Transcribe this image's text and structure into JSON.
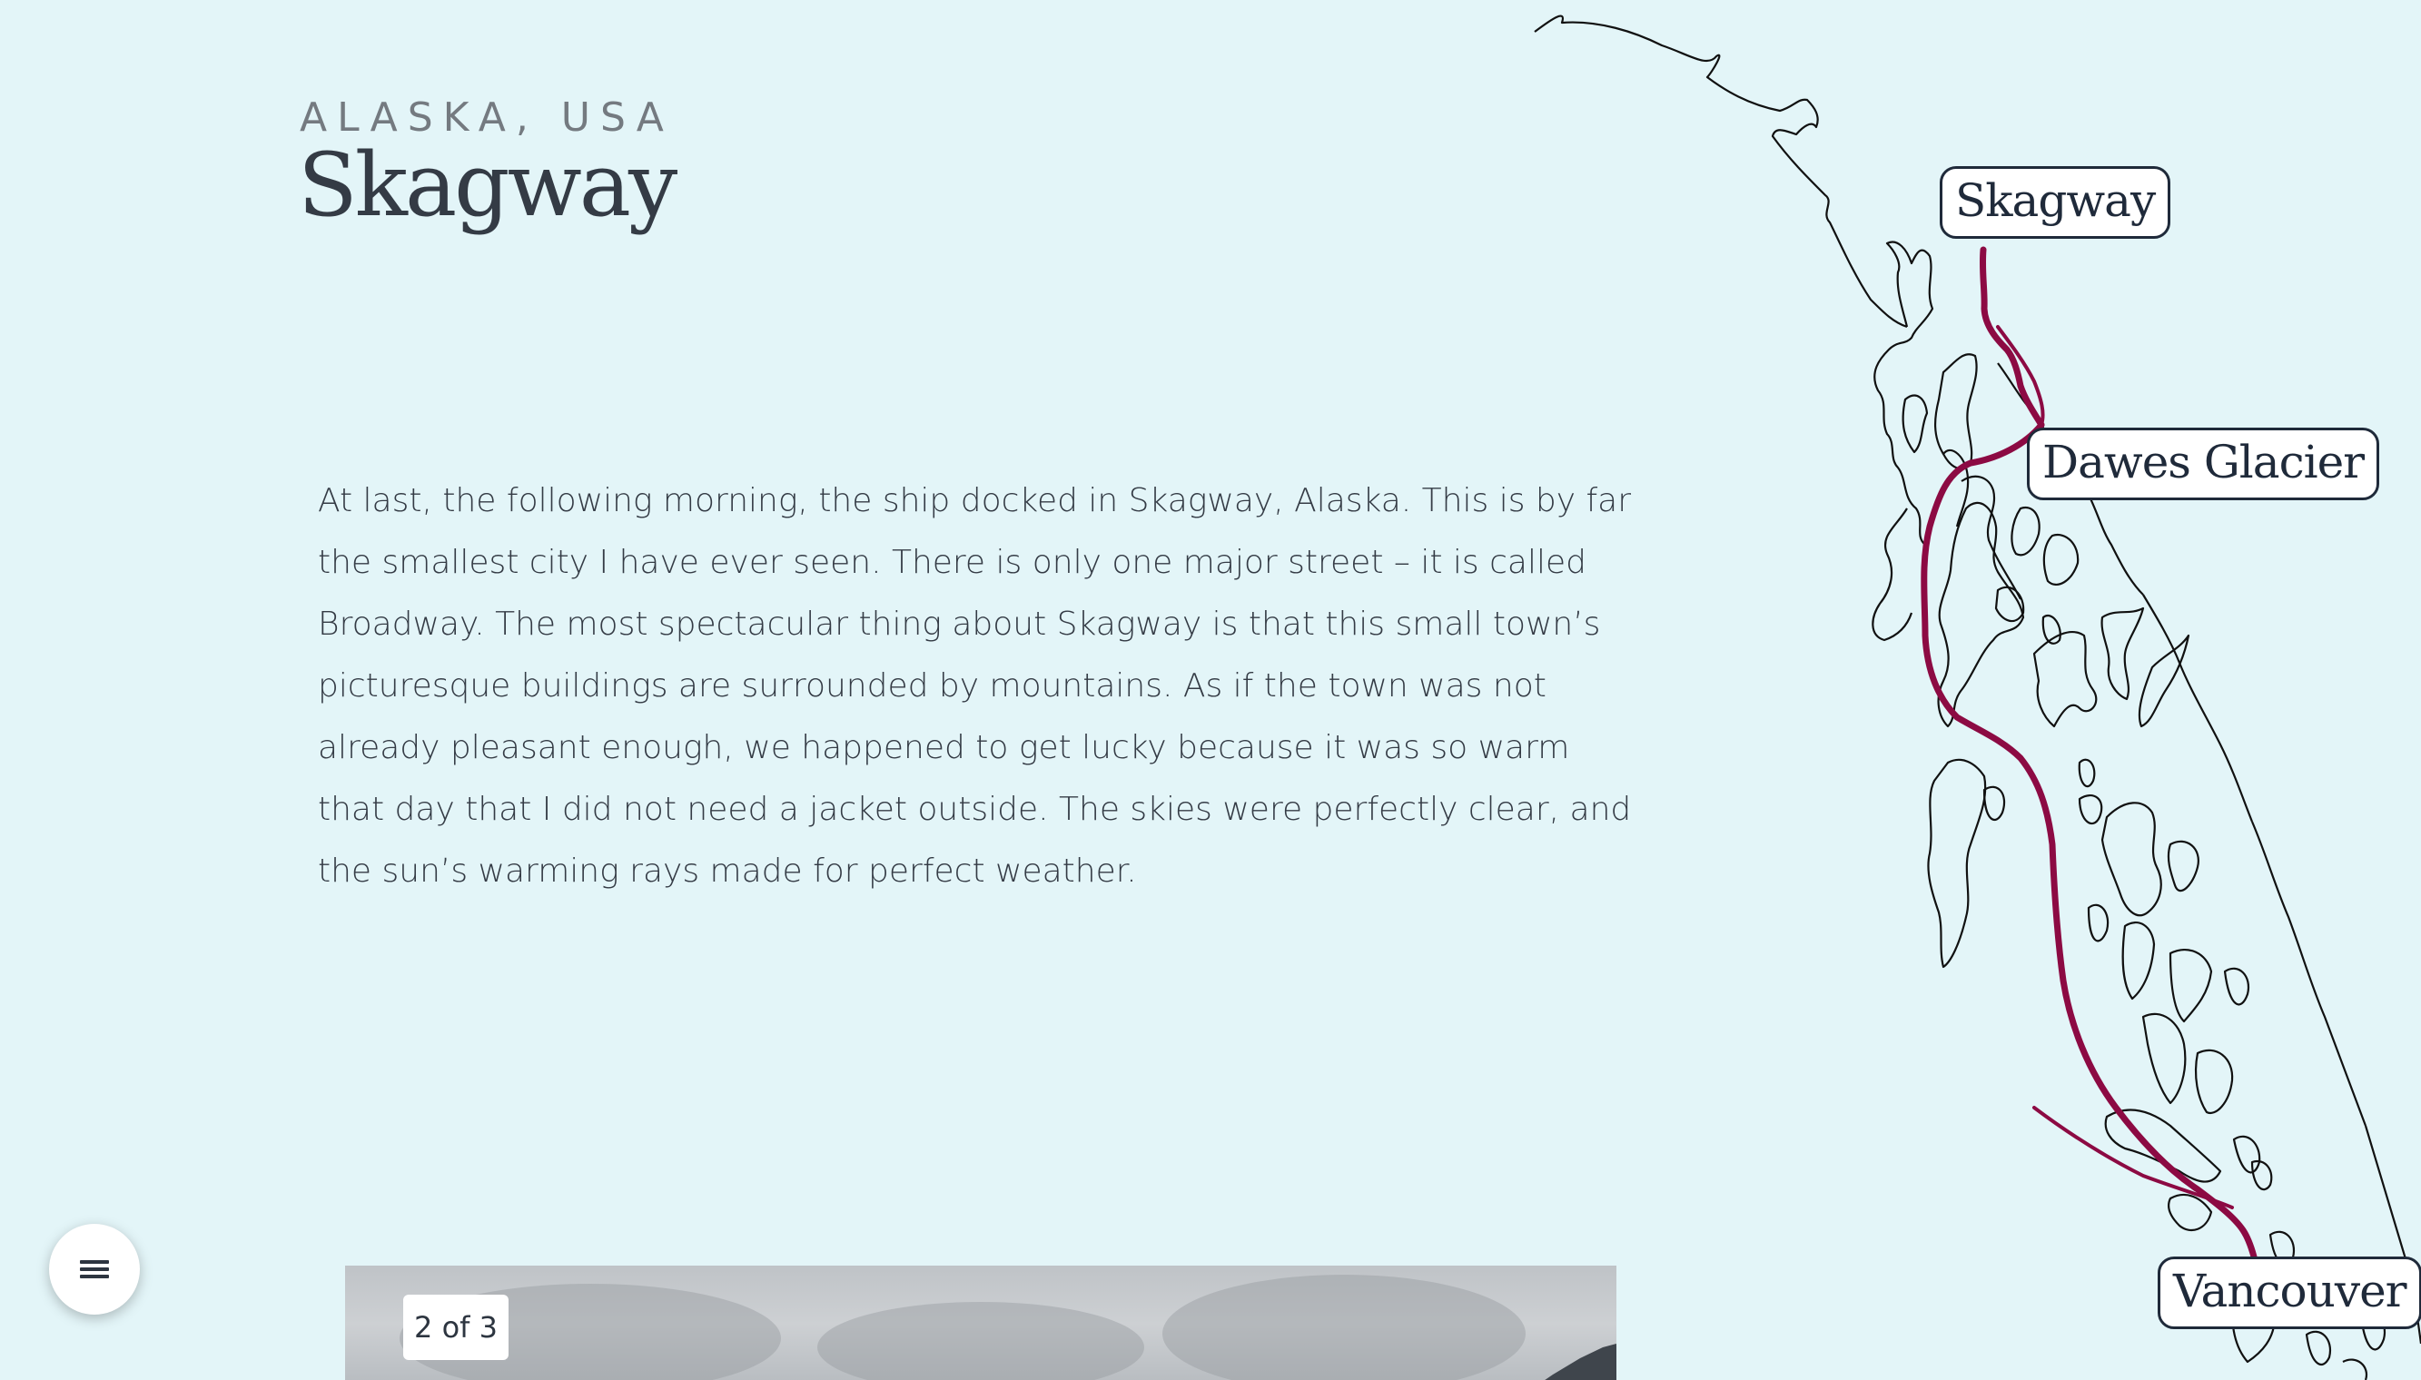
{
  "header": {
    "eyebrow": "ALASKA, USA",
    "title": "Skagway"
  },
  "story": {
    "paragraph": "At last, the following morning, the ship docked in Skagway, Alaska. This is by far the smallest city I have ever seen. There is only one major street – it is called Broadway. The most spectacular thing about Skagway is that this small town’s picturesque buildings are surrounded by mountains. As if the town was not already pleasant enough, we happened to get lucky because it was so warm that day that I did not need a jacket outside. The skies were perfectly clear, and the sun’s warming rays made for perfect weather."
  },
  "gallery": {
    "counter": "2 of 3"
  },
  "map": {
    "labels": {
      "skagway": "Skagway",
      "dawes": "Dawes Glacier",
      "vancouver": "Vancouver"
    },
    "route_color": "#8c0a43",
    "coast_color": "#111111"
  },
  "menu": {
    "icon": "hamburger-menu-icon"
  },
  "colors": {
    "background": "#e3f5f8",
    "text": "#343b45",
    "eyebrow": "#747a80"
  }
}
